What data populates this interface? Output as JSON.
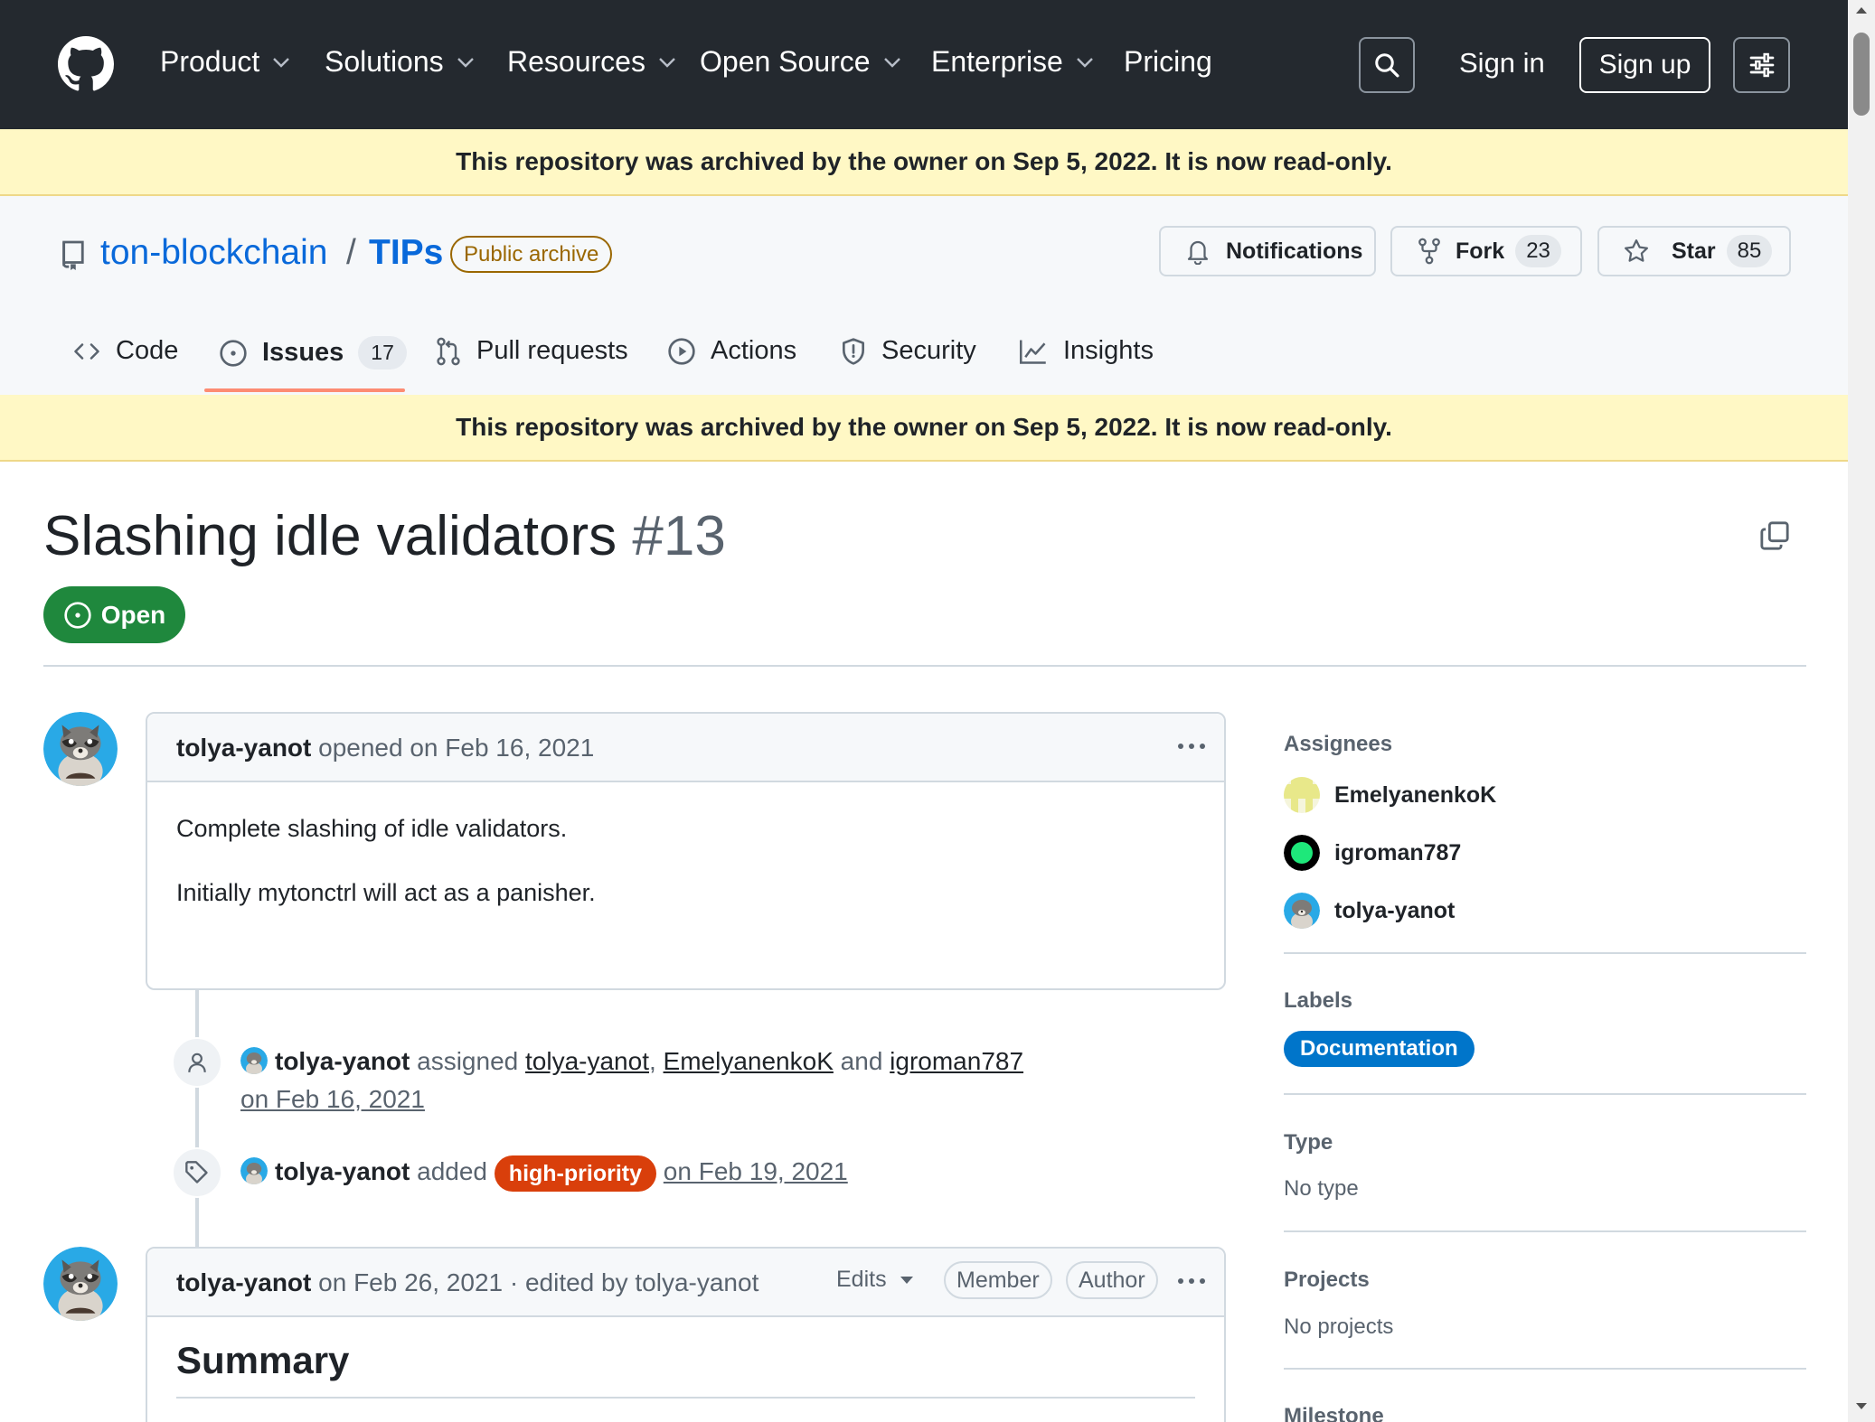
{
  "header": {
    "nav": [
      {
        "label": "Product",
        "has_menu": true
      },
      {
        "label": "Solutions",
        "has_menu": true
      },
      {
        "label": "Resources",
        "has_menu": true
      },
      {
        "label": "Open Source",
        "has_menu": true
      },
      {
        "label": "Enterprise",
        "has_menu": true
      },
      {
        "label": "Pricing",
        "has_menu": false
      }
    ],
    "sign_in": "Sign in",
    "sign_up": "Sign up"
  },
  "banner": {
    "text": "This repository was archived by the owner on Sep 5, 2022. It is now read-only."
  },
  "repo": {
    "owner": "ton-blockchain",
    "separator": "/",
    "name": "TIPs",
    "visibility": "Public archive",
    "notifications_label": "Notifications",
    "fork_label": "Fork",
    "fork_count": "23",
    "star_label": "Star",
    "star_count": "85"
  },
  "tabs": [
    {
      "label": "Code",
      "icon": "code-icon"
    },
    {
      "label": "Issues",
      "icon": "issue-icon",
      "count": "17",
      "selected": true
    },
    {
      "label": "Pull requests",
      "icon": "pull-request-icon"
    },
    {
      "label": "Actions",
      "icon": "play-icon"
    },
    {
      "label": "Security",
      "icon": "shield-icon"
    },
    {
      "label": "Insights",
      "icon": "graph-icon"
    }
  ],
  "issue": {
    "title": "Slashing idle validators",
    "number": "#13",
    "state": "Open"
  },
  "comments": [
    {
      "author": "tolya-yanot",
      "meta": "opened on Feb 16, 2021",
      "body": [
        "Complete slashing of idle validators.",
        "Initially mytonctrl will act as a panisher."
      ]
    },
    {
      "author": "tolya-yanot",
      "meta": "on Feb 26, 2021 · edited by tolya-yanot",
      "edits_label": "Edits",
      "badges": [
        "Member",
        "Author"
      ],
      "heading": "Summary"
    }
  ],
  "events": {
    "assigned": {
      "actor": "tolya-yanot",
      "verb": "assigned",
      "users": [
        "tolya-yanot",
        "EmelyanenkoK",
        "igroman787"
      ],
      "comma": ",",
      "and": "and",
      "date": "on Feb 16, 2021"
    },
    "labeled": {
      "actor": "tolya-yanot",
      "verb": "added",
      "label": "high-priority",
      "date": "on Feb 19, 2021"
    }
  },
  "sidebar": {
    "assignees_heading": "Assignees",
    "assignees": [
      "EmelyanenkoK",
      "igroman787",
      "tolya-yanot"
    ],
    "labels_heading": "Labels",
    "labels": [
      "Documentation"
    ],
    "type_heading": "Type",
    "type_value": "No type",
    "projects_heading": "Projects",
    "projects_value": "No projects",
    "milestone_heading": "Milestone"
  },
  "colors": {
    "header_bg": "#24292f",
    "banner_bg": "#fff8c5",
    "link": "#0969da",
    "open_green": "#1f883d",
    "high_priority": "#d93f0b",
    "documentation": "#0075ca",
    "tab_underline": "#fd8c73"
  }
}
